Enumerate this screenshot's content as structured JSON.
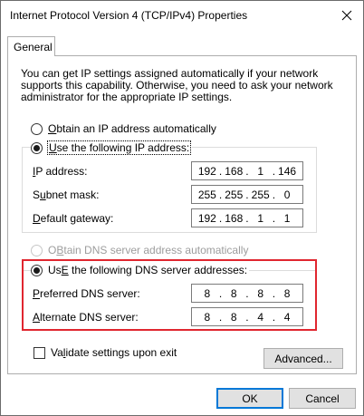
{
  "window": {
    "title": "Internet Protocol Version 4 (TCP/IPv4) Properties"
  },
  "tabs": [
    {
      "label": "General"
    }
  ],
  "description": "You can get IP settings assigned automatically if your network supports this capability. Otherwise, you need to ask your network administrator for the appropriate IP settings.",
  "ip_section": {
    "auto_option": {
      "label_pre": "",
      "label_key": "O",
      "label_post": "btain an IP address automatically",
      "selected": false
    },
    "manual_option": {
      "label_pre": "",
      "label_key": "U",
      "label_post": "se the following IP address:",
      "selected": true
    },
    "fields": {
      "ip_address": {
        "label_key": "I",
        "label_post": "P address:",
        "segments": [
          "192",
          "168",
          "1",
          "146"
        ]
      },
      "subnet_mask": {
        "label_pre": "S",
        "label_key": "u",
        "label_post": "bnet mask:",
        "segments": [
          "255",
          "255",
          "255",
          "0"
        ]
      },
      "default_gateway": {
        "label_key": "D",
        "label_post": "efault gateway:",
        "segments": [
          "192",
          "168",
          "1",
          "1"
        ]
      }
    }
  },
  "dns_section": {
    "auto_option": {
      "label_key": "B",
      "label_pre": "O",
      "label_post": "tain DNS server address automatically",
      "selected": false,
      "disabled": true
    },
    "manual_option": {
      "label_key": "E",
      "label_pre": "Us",
      "label_post": " the following DNS server addresses:",
      "selected": true
    },
    "fields": {
      "preferred": {
        "label_key": "P",
        "label_post": "referred DNS server:",
        "segments": [
          "8",
          "8",
          "8",
          "8"
        ]
      },
      "alternate": {
        "label_key": "A",
        "label_post": "lternate DNS server:",
        "segments": [
          "8",
          "8",
          "4",
          "4"
        ]
      }
    }
  },
  "validate": {
    "label_pre": "Va",
    "label_key": "l",
    "label_post": "idate settings upon exit",
    "checked": false
  },
  "buttons": {
    "advanced": "Advanced...",
    "ok": "OK",
    "cancel": "Cancel"
  },
  "colors": {
    "highlight": "#e0262f",
    "default_button_border": "#0078d7"
  }
}
